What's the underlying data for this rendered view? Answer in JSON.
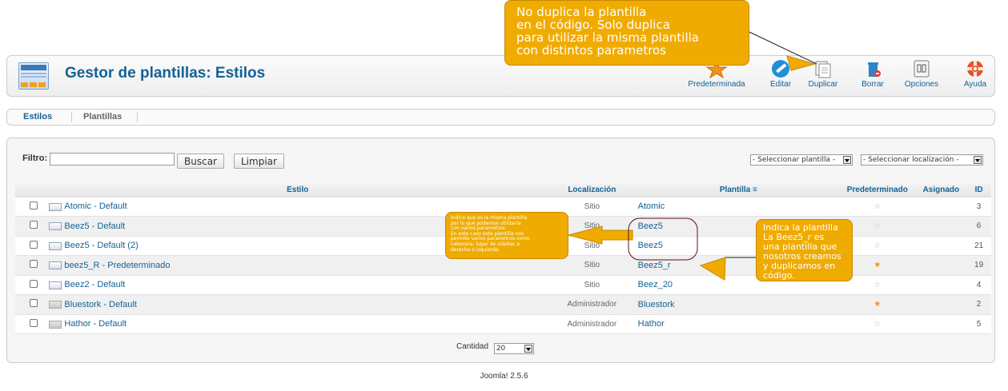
{
  "header": {
    "title": "Gestor de plantillas: Estilos",
    "toolbar": [
      {
        "label": "Predeterminada",
        "icon": "star-icon"
      },
      {
        "label": "Editar",
        "icon": "edit-icon"
      },
      {
        "label": "Duplicar",
        "icon": "duplicate-icon"
      },
      {
        "label": "Borrar",
        "icon": "trash-icon"
      },
      {
        "label": "Opciones",
        "icon": "options-icon"
      },
      {
        "label": "Ayuda",
        "icon": "help-icon"
      }
    ]
  },
  "subnav": {
    "tabs": [
      {
        "label": "Estilos",
        "active": true
      },
      {
        "label": "Plantillas",
        "active": false
      }
    ]
  },
  "filter": {
    "label": "Filtro:",
    "value": "",
    "search_button": "Buscar",
    "clear_button": "Limpiar",
    "template_select": "- Seleccionar plantilla -",
    "location_select": "- Seleccionar localización -"
  },
  "table": {
    "columns": [
      "Estilo",
      "Localización",
      "Plantilla",
      "Predeterminado",
      "Asignado",
      "ID"
    ],
    "rows": [
      {
        "style": "Atomic - Default",
        "location": "Sitio",
        "template": "Atomic",
        "default": false,
        "id": "3"
      },
      {
        "style": "Beez5 - Default",
        "location": "Sitio",
        "template": "Beez5",
        "default": false,
        "id": "6"
      },
      {
        "style": "Beez5 - Default (2)",
        "location": "Sitio",
        "template": "Beez5",
        "default": false,
        "id": "21"
      },
      {
        "style": "beez5_R - Predeterminado",
        "location": "Sitio",
        "template": "Beez5_r",
        "default": true,
        "id": "19"
      },
      {
        "style": "Beez2 - Default",
        "location": "Sitio",
        "template": "Beez_20",
        "default": false,
        "id": "4"
      },
      {
        "style": "Bluestork - Default",
        "location": "Administrador",
        "template": "Bluestork",
        "default": true,
        "id": "2"
      },
      {
        "style": "Hathor - Default",
        "location": "Administrador",
        "template": "Hathor",
        "default": false,
        "id": "5"
      }
    ]
  },
  "pagination": {
    "label": "Cantidad",
    "value": "20"
  },
  "footer": {
    "version": "Joomla! 2.5.6"
  },
  "annotations": {
    "duplicate_note": "No duplica la plantilla\nen el código. Solo duplica\npara utilizar la misma plantilla\ncon distintos parametros",
    "same_template_note": "Indica que es la misma plantilla\npor lo que podemos utilizarla\ncon varios parametros.\nEn este caso esta plantilla nos\npermite varios parametros como\ncabecera, lugar de sidebar a\nderecha o izquierda.",
    "beez5r_note": "Indica la plantilla\nLa Beez5_r es\nuna plantilla que\nnosotros creamos\ny duplicamos en\ncódigo."
  },
  "colors": {
    "accent": "#146295",
    "callout": "#f0ab00",
    "star_on": "#f2911b"
  }
}
